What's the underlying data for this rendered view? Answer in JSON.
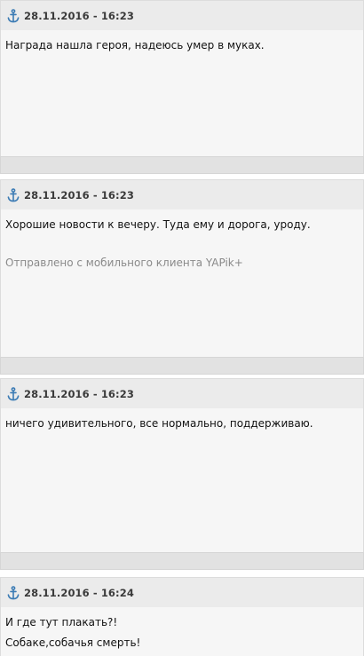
{
  "colors": {
    "header_bg": "#ebebeb",
    "body_bg": "#f6f6f6",
    "footer_bg": "#e2e2e2",
    "anchor_icon": "#3b7bb4",
    "signature_text": "#8a8a8a"
  },
  "posts": [
    {
      "icon": "anchor-icon",
      "date": "28.11.2016 - 16:23",
      "lines": [
        "Награда нашла героя, надеюсь умер в муках."
      ]
    },
    {
      "icon": "anchor-icon",
      "date": "28.11.2016 - 16:23",
      "lines": [
        "Хорошие новости к вечеру. Туда ему и дорога, уроду."
      ],
      "signature": "Отправлено с мобильного клиента YAPik+"
    },
    {
      "icon": "anchor-icon",
      "date": "28.11.2016 - 16:23",
      "lines": [
        "ничего удивительного, все нормально, поддерживаю."
      ]
    },
    {
      "icon": "anchor-icon",
      "date": "28.11.2016 - 16:24",
      "lines": [
        "И где тут плакать?!",
        "Собаке,собачья смерть!"
      ]
    }
  ]
}
